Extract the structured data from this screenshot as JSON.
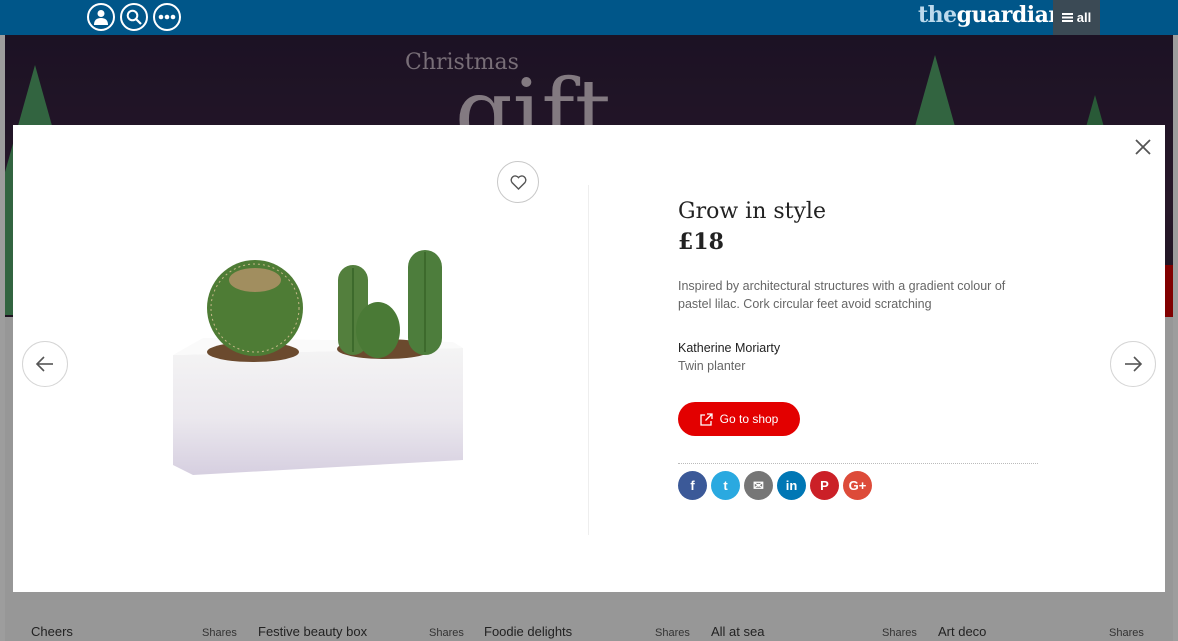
{
  "header": {
    "logo_prefix": "the",
    "logo_main": "guardian",
    "menu_label": "all",
    "icons": [
      "profile-icon",
      "search-icon",
      "more-icon"
    ]
  },
  "hero": {
    "line1": "Christmas",
    "line2": "gift"
  },
  "strip": {
    "items": [
      {
        "title": "Cheers",
        "shares": "Shares"
      },
      {
        "title": "Festive beauty box",
        "shares": "Shares"
      },
      {
        "title": "Foodie delights",
        "shares": "Shares"
      },
      {
        "title": "All at sea",
        "shares": "Shares"
      },
      {
        "title": "Art deco",
        "shares": "Shares"
      }
    ]
  },
  "product": {
    "title": "Grow in style",
    "price": "£18",
    "description": "Inspired by architectural structures with a gradient colour of pastel lilac. Cork circular feet avoid scratching",
    "brand": "Katherine Moriarty",
    "name": "Twin planter",
    "shop_label": "Go to shop"
  },
  "social": [
    {
      "name": "facebook",
      "glyph": "f",
      "color": "#3b5998"
    },
    {
      "name": "twitter",
      "glyph": "t",
      "color": "#2aa9e0"
    },
    {
      "name": "email",
      "glyph": "✉",
      "color": "#767676"
    },
    {
      "name": "linkedin",
      "glyph": "in",
      "color": "#0077b5"
    },
    {
      "name": "pinterest",
      "glyph": "P",
      "color": "#cb2027"
    },
    {
      "name": "googleplus",
      "glyph": "G+",
      "color": "#dd4b39"
    }
  ],
  "colors": {
    "header_bg": "#005689",
    "shop_button": "#e30000"
  }
}
